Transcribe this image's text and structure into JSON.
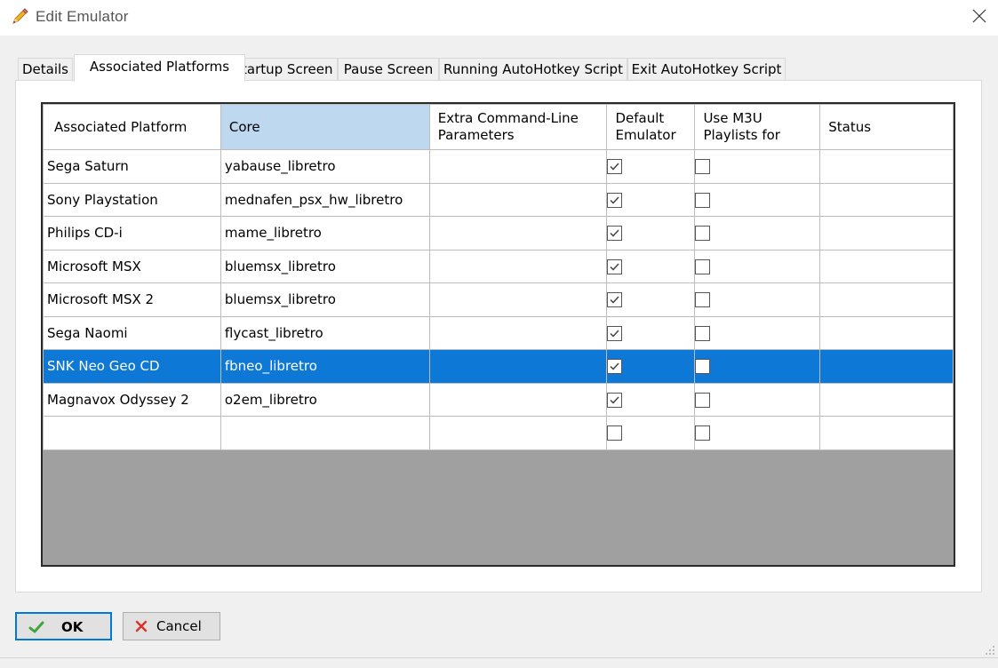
{
  "window": {
    "title": "Edit Emulator",
    "icon": "pencil-icon",
    "close_icon": "close-icon"
  },
  "tabs": [
    {
      "label": "Details",
      "active": false
    },
    {
      "label": "Associated Platforms",
      "active": true
    },
    {
      "label": "Startup Screen",
      "active": false
    },
    {
      "label": "Pause Screen",
      "active": false
    },
    {
      "label": "Running AutoHotkey Script",
      "active": false
    },
    {
      "label": "Exit AutoHotkey Script",
      "active": false
    }
  ],
  "grid": {
    "columns": [
      {
        "label": "Associated Platform"
      },
      {
        "label": "Core",
        "highlighted": true
      },
      {
        "label": "Extra Command-Line Parameters"
      },
      {
        "label": "Default Emulator"
      },
      {
        "label": "Use M3U Playlists for"
      },
      {
        "label": "Status"
      }
    ],
    "rows": [
      {
        "platform": "Sega Saturn",
        "core": "yabause_libretro",
        "params": "",
        "default": true,
        "m3u": false,
        "status": ""
      },
      {
        "platform": "Sony Playstation",
        "core": "mednafen_psx_hw_libretro",
        "params": "",
        "default": true,
        "m3u": false,
        "status": ""
      },
      {
        "platform": "Philips CD-i",
        "core": "mame_libretro",
        "params": "",
        "default": true,
        "m3u": false,
        "status": ""
      },
      {
        "platform": "Microsoft MSX",
        "core": "bluemsx_libretro",
        "params": "",
        "default": true,
        "m3u": false,
        "status": ""
      },
      {
        "platform": "Microsoft MSX 2",
        "core": "bluemsx_libretro",
        "params": "",
        "default": true,
        "m3u": false,
        "status": ""
      },
      {
        "platform": "Sega Naomi",
        "core": "flycast_libretro",
        "params": "",
        "default": true,
        "m3u": false,
        "status": ""
      },
      {
        "platform": "SNK Neo Geo CD",
        "core": "fbneo_libretro",
        "params": "",
        "default": true,
        "m3u": false,
        "status": "",
        "selected": true
      },
      {
        "platform": "Magnavox Odyssey 2",
        "core": "o2em_libretro",
        "params": "",
        "default": true,
        "m3u": false,
        "status": ""
      },
      {
        "platform": "",
        "core": "",
        "params": "",
        "default": false,
        "m3u": false,
        "status": ""
      }
    ],
    "colors": {
      "selected_row": "#0e78d7",
      "highlighted_header": "#bdd8ef",
      "empty_area": "#a0a0a0"
    }
  },
  "buttons": {
    "ok_label": "OK",
    "ok_icon": "checkmark-icon",
    "cancel_label": "Cancel",
    "cancel_icon": "red-x-icon"
  }
}
